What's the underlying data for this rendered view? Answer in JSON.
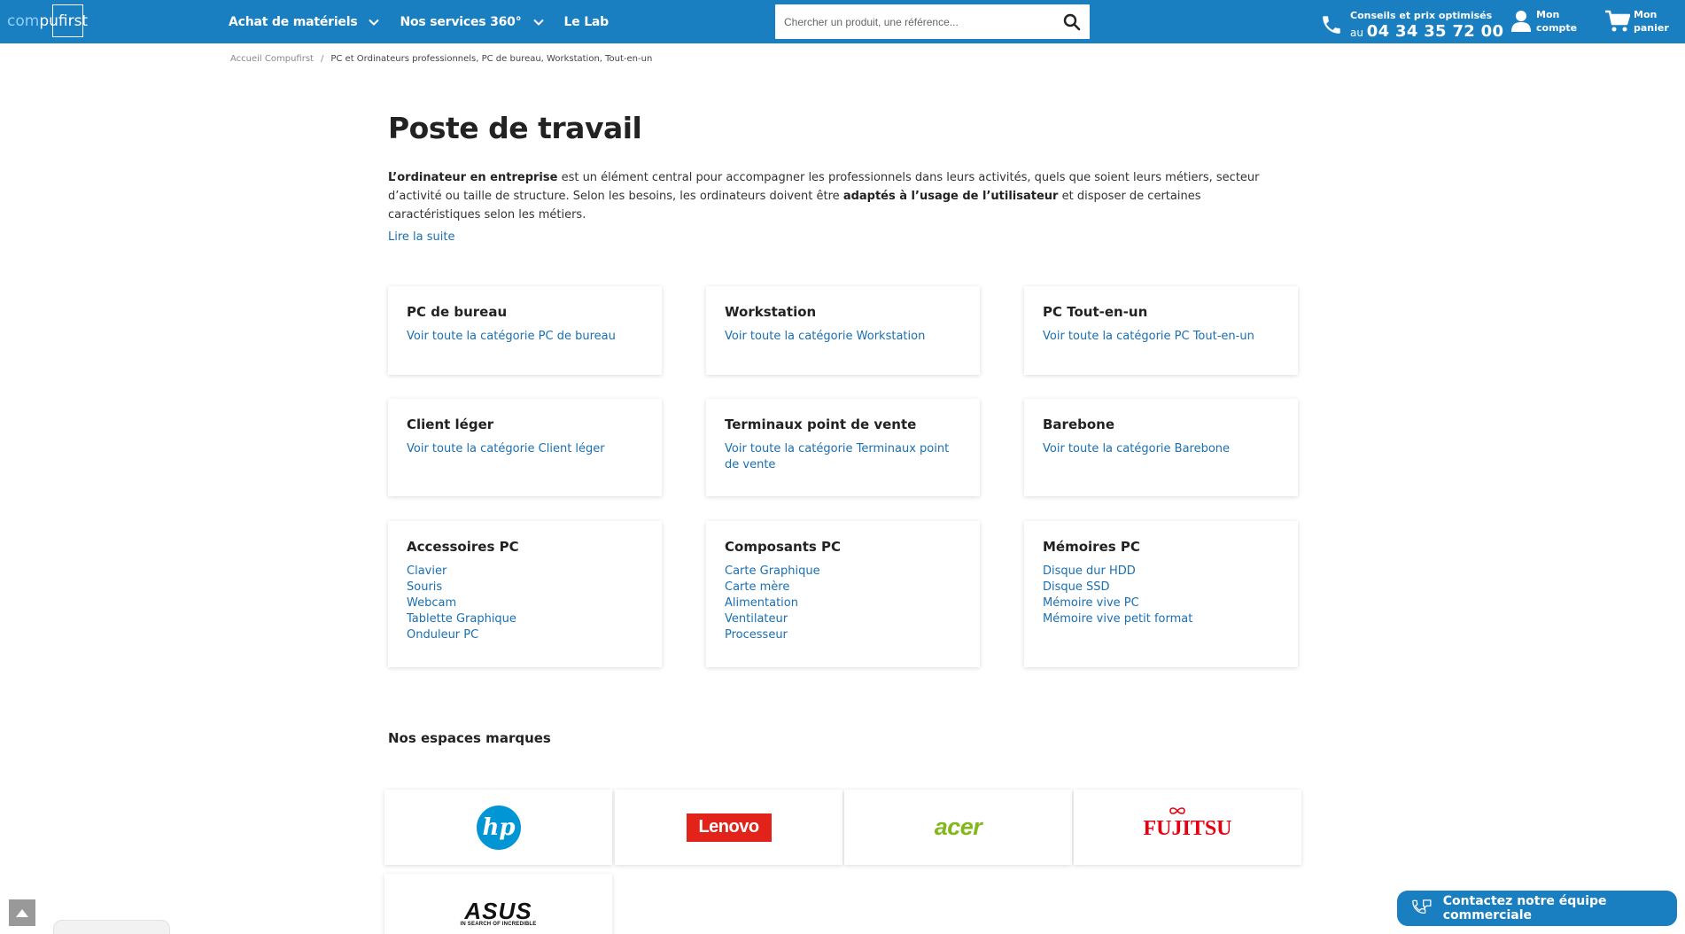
{
  "header": {
    "logo": {
      "part1": "com",
      "part2": "pufirst"
    },
    "nav": [
      {
        "label": "Achat de matériels",
        "has_dropdown": true
      },
      {
        "label": "Nos services 360°",
        "has_dropdown": true
      },
      {
        "label": "Le Lab",
        "has_dropdown": false
      }
    ],
    "search": {
      "placeholder": "Chercher un produit, une référence..."
    },
    "contact": {
      "line1": "Conseils et prix optimisés",
      "prefix": "au",
      "phone": "04 34 35 72 00"
    },
    "account_label": "Mon compte",
    "cart_label": "Mon panier"
  },
  "breadcrumb": {
    "home": "Accueil Compufirst",
    "separator": "/",
    "current": "PC et Ordinateurs professionnels, PC de bureau, Workstation, Tout-en-un"
  },
  "main": {
    "title": "Poste de travail",
    "intro": {
      "b1": "L’ordinateur en entreprise",
      "t1": " est un élément central pour accompagner les professionnels dans leurs activités, quels que soient leurs métiers, secteur d’activité ou taille de structure. Selon les besoins, les ordinateurs doivent être ",
      "b2": "adaptés à l’usage de l’utilisateur",
      "t2": " et disposer de certaines caractéristiques selon les métiers."
    },
    "read_more": "Lire la suite"
  },
  "categories": [
    {
      "title": "PC de bureau",
      "links": [
        "Voir toute la catégorie PC de bureau"
      ]
    },
    {
      "title": "Workstation",
      "links": [
        "Voir toute la catégorie Workstation"
      ]
    },
    {
      "title": "PC Tout-en-un",
      "links": [
        "Voir toute la catégorie PC Tout-en-un"
      ]
    },
    {
      "title": "Client léger",
      "links": [
        "Voir toute la catégorie Client léger"
      ]
    },
    {
      "title": "Terminaux point de vente",
      "links": [
        "Voir toute la catégorie Terminaux point de vente"
      ]
    },
    {
      "title": "Barebone",
      "links": [
        "Voir toute la catégorie Barebone"
      ]
    },
    {
      "title": "Accessoires PC",
      "links": [
        "Clavier",
        "Souris",
        "Webcam",
        "Tablette Graphique",
        "Onduleur PC"
      ]
    },
    {
      "title": "Composants PC",
      "links": [
        "Carte Graphique",
        "Carte mère",
        "Alimentation",
        "Ventilateur",
        "Processeur"
      ]
    },
    {
      "title": "Mémoires PC",
      "links": [
        "Disque dur HDD",
        "Disque SSD",
        "Mémoire vive PC",
        "Mémoire vive petit format"
      ]
    }
  ],
  "brands": {
    "title": "Nos espaces marques",
    "items": [
      {
        "name": "hp",
        "color": "#0096d6"
      },
      {
        "name": "Lenovo",
        "color": "#e2231a"
      },
      {
        "name": "acer",
        "color": "#83b81a"
      },
      {
        "name": "FUJITSU",
        "color": "#e60012"
      },
      {
        "name": "ASUS",
        "tagline": "IN SEARCH OF INCREDIBLE",
        "color": "#111111"
      }
    ]
  },
  "floating": {
    "contact_button": "Contactez notre équipe commerciale"
  },
  "colors": {
    "brand_blue": "#1a7fc1",
    "link_blue": "#1a6fb0"
  }
}
